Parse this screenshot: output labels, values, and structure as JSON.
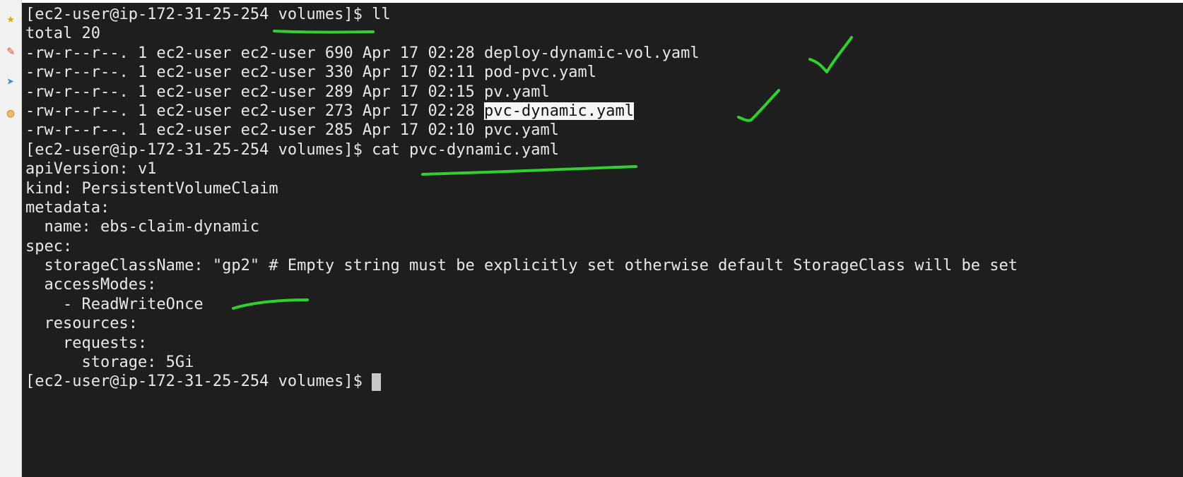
{
  "colors": {
    "terminal_bg": "#1e1e1e",
    "text": "#e8e8e8",
    "annotation": "#2ed12e"
  },
  "toolbar": {
    "icons": [
      {
        "name": "star-icon",
        "glyph": "★",
        "color": "#e0a800"
      },
      {
        "name": "marker-icon",
        "glyph": "✎",
        "color": "#e05030"
      },
      {
        "name": "send-icon",
        "glyph": "➤",
        "color": "#3a8fd8"
      },
      {
        "name": "palette-icon",
        "glyph": "◍",
        "color": "#e08a10"
      }
    ]
  },
  "terminal": {
    "prompt": "[ec2-user@ip-172-31-25-254 volumes]$ ",
    "lines": [
      "[ec2-user@ip-172-31-25-254 volumes]$ ll",
      "total 20",
      "-rw-r--r--. 1 ec2-user ec2-user 690 Apr 17 02:28 deploy-dynamic-vol.yaml",
      "-rw-r--r--. 1 ec2-user ec2-user 330 Apr 17 02:11 pod-pvc.yaml",
      "-rw-r--r--. 1 ec2-user ec2-user 289 Apr 17 02:15 pv.yaml",
      {
        "prefix": "-rw-r--r--. 1 ec2-user ec2-user 273 Apr 17 02:28 ",
        "highlight": "pvc-dynamic.yaml"
      },
      "-rw-r--r--. 1 ec2-user ec2-user 285 Apr 17 02:10 pvc.yaml",
      "[ec2-user@ip-172-31-25-254 volumes]$ cat pvc-dynamic.yaml",
      "apiVersion: v1",
      "kind: PersistentVolumeClaim",
      "metadata:",
      "  name: ebs-claim-dynamic",
      "spec:",
      "  storageClassName: \"gp2\" # Empty string must be explicitly set otherwise default StorageClass will be set",
      "  accessModes:",
      "    - ReadWriteOnce",
      "  resources:",
      "    requests:",
      "      storage: 5Gi"
    ]
  }
}
